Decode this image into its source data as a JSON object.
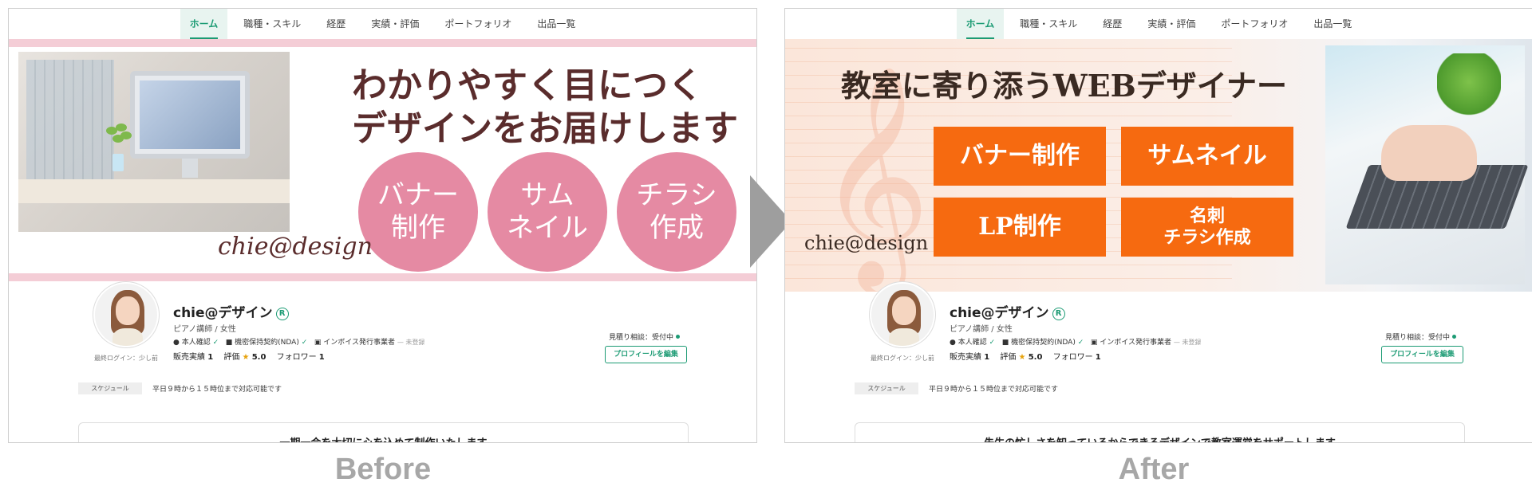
{
  "nav_tabs": [
    "ホーム",
    "職種・スキル",
    "経歴",
    "実績・評価",
    "ポートフォリオ",
    "出品一覧"
  ],
  "before": {
    "headline_line1": "わかりやすく目につく",
    "headline_line2": "デザインをお届けします",
    "circles": [
      {
        "line1": "バナー",
        "line2": "制作"
      },
      {
        "line1": "サム",
        "line2": "ネイル"
      },
      {
        "line1": "チラシ",
        "line2": "作成"
      }
    ],
    "signature": "chie@design",
    "tagline": "一期一会を大切に心を込めて制作いたします"
  },
  "after": {
    "headline": "教室に寄り添うWEBデザイナー",
    "boxes": [
      {
        "line1": "バナー制作",
        "line2": ""
      },
      {
        "line1": "サムネイル",
        "line2": ""
      },
      {
        "line1": "LP制作",
        "line2": ""
      },
      {
        "line1": "名刺",
        "line2": "チラシ作成"
      }
    ],
    "signature": "chie@design",
    "tagline": "先生の忙しさを知っているからできるデザインで教室運営をサポートします"
  },
  "profile": {
    "name": "chie@デザイン",
    "reg_mark": "R",
    "subtitle": "ピアノ講師 / 女性",
    "last_login": "最終ログイン：少し前",
    "badge_identity": "本人確認",
    "badge_nda": "機密保持契約(NDA)",
    "badge_invoice": "インボイス発行事業者",
    "badge_invoice_status": "未登録",
    "sales_label": "販売実績",
    "sales_value": "1",
    "rating_label": "評価",
    "rating_value": "5.0",
    "followers_label": "フォロワー",
    "followers_value": "1",
    "estimate_status": "見積り相談：受付中",
    "edit_button": "プロフィールを編集",
    "schedule_label": "スケジュール",
    "schedule_text": "平日９時から１５時位まで対応可能です"
  },
  "captions": {
    "before": "Before",
    "after": "After"
  },
  "colors": {
    "accent": "#1c9b74",
    "circle_pink": "#e58aa3",
    "box_orange": "#f66a10"
  }
}
